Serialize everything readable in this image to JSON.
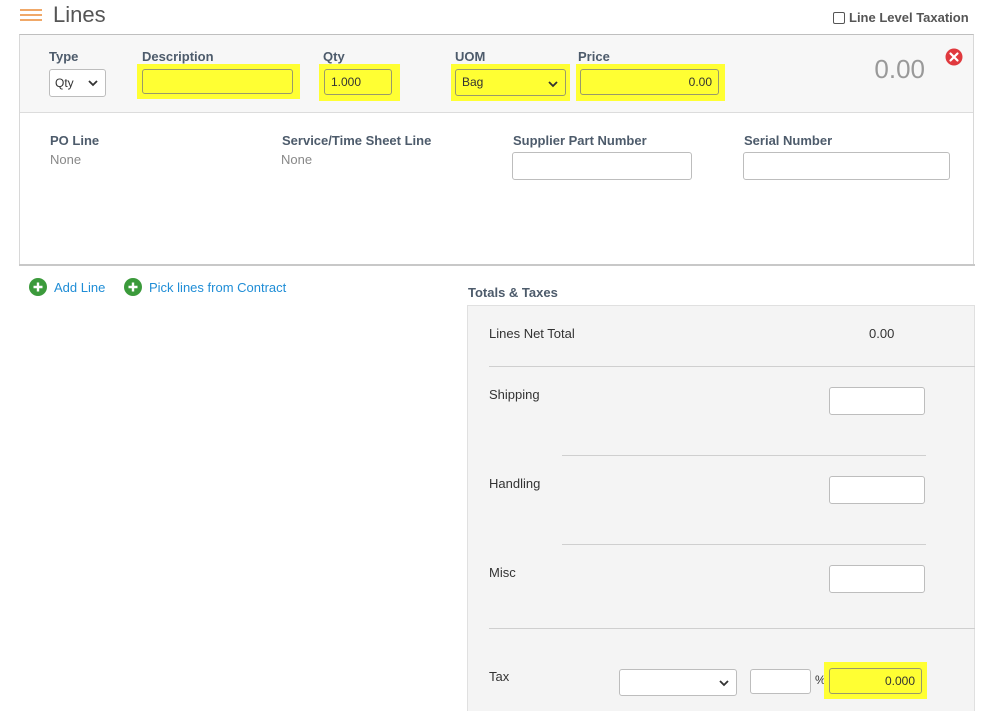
{
  "header": {
    "title": "Lines",
    "line_level_taxation_label": "Line Level Taxation"
  },
  "line": {
    "columns": {
      "type": "Type",
      "description": "Description",
      "qty": "Qty",
      "uom": "UOM",
      "price": "Price"
    },
    "type_value": "Qty",
    "description_value": "",
    "qty_value": "1.000",
    "uom_value": "Bag",
    "price_value": "0.00",
    "line_total": "0.00",
    "details": {
      "po_line_label": "PO Line",
      "po_line_value": "None",
      "service_sheet_label": "Service/Time Sheet Line",
      "service_sheet_value": "None",
      "supplier_part_label": "Supplier Part Number",
      "serial_label": "Serial Number"
    }
  },
  "actions": {
    "add_line": "Add Line",
    "pick_lines": "Pick lines from Contract"
  },
  "totals": {
    "title": "Totals & Taxes",
    "lines_net_total_label": "Lines Net Total",
    "lines_net_total_value": "0.00",
    "shipping_label": "Shipping",
    "handling_label": "Handling",
    "misc_label": "Misc",
    "tax_label": "Tax",
    "percent_symbol": "%",
    "tax_amount": "0.000"
  },
  "colors": {
    "highlight": "#ffff33",
    "link": "#1f8dd6",
    "remove": "#e0393e",
    "add": "#3b9a3b",
    "lines_icon": "#f0a868"
  }
}
